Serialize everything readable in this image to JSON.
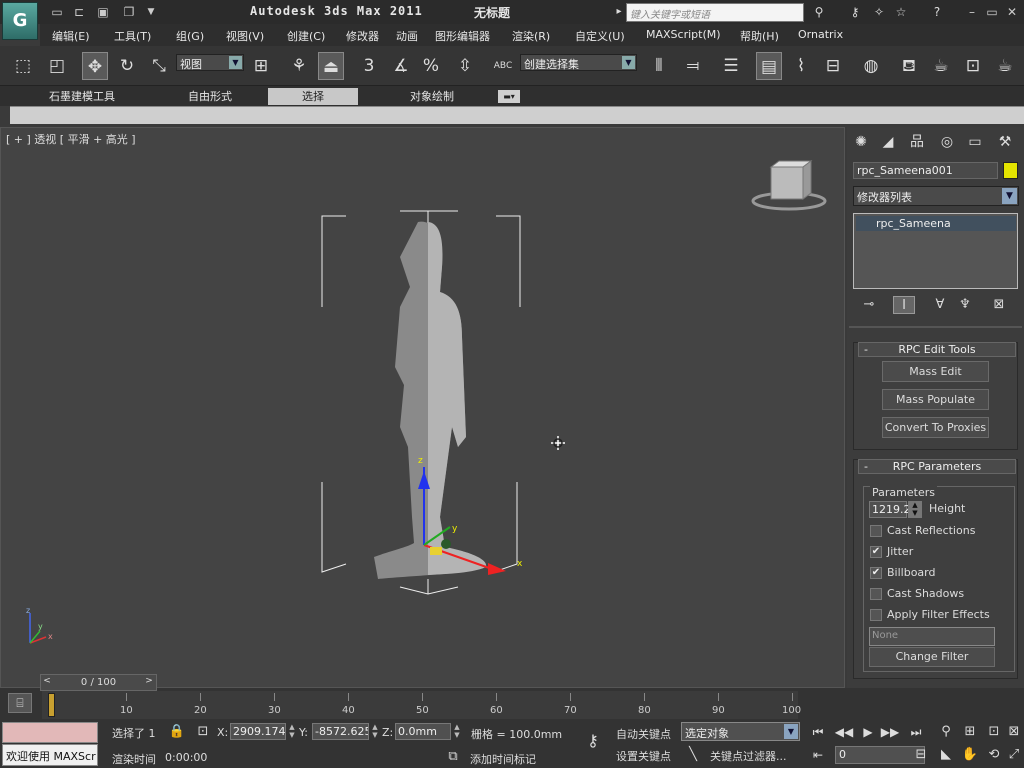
{
  "titlebar": {
    "logo": "G",
    "app_title": "Autodesk 3ds Max  2011",
    "doc_title": "无标题",
    "search_placeholder": "键入关键字或短语",
    "win_min": "–",
    "win_restore": "▭",
    "win_close": "✕"
  },
  "menu": [
    "编辑(E)",
    "工具(T)",
    "组(G)",
    "视图(V)",
    "创建(C)",
    "修改器",
    "动画",
    "图形编辑器",
    "渲染(R)",
    "自定义(U)",
    "MAXScript(M)",
    "帮助(H)",
    "Ornatrix"
  ],
  "toolbar": {
    "view_select": "视图",
    "named_selection": "创建选择集",
    "snap_3": "3",
    "snap_percent": "%",
    "abc": "ABC"
  },
  "ribbon": {
    "tabs": [
      "石墨建模工具",
      "自由形式",
      "选择",
      "对象绘制"
    ],
    "active_tab": "选择"
  },
  "viewport": {
    "label": "[ + ] 透视 [ 平滑 + 高光 ]",
    "gizmo_x": "x",
    "gizmo_y": "y",
    "gizmo_z": "z",
    "axis_x": "x",
    "axis_y": "y",
    "axis_z": "z"
  },
  "command_panel": {
    "object_name": "rpc_Sameena001",
    "object_color": "#e4e400",
    "modifier_list": "修改器列表",
    "stack_item": "rpc_Sameena",
    "rpc_edit_tools": {
      "title": "RPC Edit Tools",
      "sign": "-",
      "buttons": [
        "Mass Edit",
        "Mass Populate",
        "Convert To Proxies"
      ]
    },
    "rpc_parameters": {
      "title": "RPC Parameters",
      "sign": "-",
      "group_label": "Parameters",
      "height_value": "1219.2",
      "height_label": "Height",
      "options": [
        {
          "label": "Cast Reflections",
          "checked": false
        },
        {
          "label": "Jitter",
          "checked": true
        },
        {
          "label": "Billboard",
          "checked": true
        },
        {
          "label": "Cast Shadows",
          "checked": false
        },
        {
          "label": "Apply Filter Effects",
          "checked": false
        }
      ],
      "filter_value": "None",
      "change_filter": "Change Filter"
    }
  },
  "timeline": {
    "slider_label": "0 / 100",
    "prev": "<",
    "next": ">",
    "ticks": [
      "0",
      "10",
      "20",
      "30",
      "40",
      "50",
      "60",
      "70",
      "80",
      "90",
      "100"
    ]
  },
  "statusbar": {
    "welcome": "欢迎使用 MAXScr",
    "selected": "选择了 1",
    "render_time_label": "渲染时间",
    "render_time_value": "0:00:00",
    "x_label": "X:",
    "x_value": "2909.174m",
    "y_label": "Y:",
    "y_value": "-8572.625t",
    "z_label": "Z:",
    "z_value": "0.0mm",
    "grid": "栅格 = 100.0mm",
    "add_time_tag": "添加时间标记",
    "auto_key": "自动关键点",
    "set_key": "设置关键点",
    "key_mode": "选定对象",
    "key_filters": "关键点过滤器...",
    "frame": "0"
  }
}
